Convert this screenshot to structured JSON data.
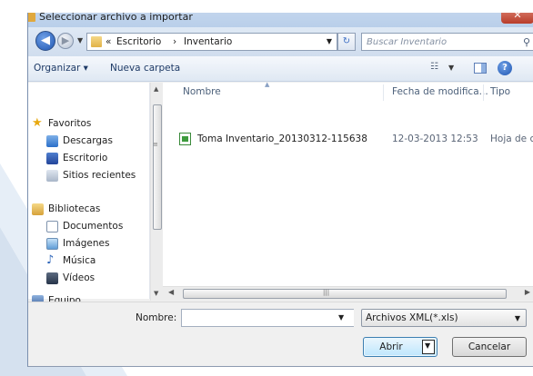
{
  "window": {
    "title": "Seleccionar archivo a importar",
    "close_glyph": "✕"
  },
  "address": {
    "overflow": "«",
    "crumbs": [
      "Escritorio",
      "Inventario"
    ],
    "separator": "›",
    "search_placeholder": "Buscar Inventario"
  },
  "toolbar": {
    "organize_label": "Organizar ▾",
    "new_folder_label": "Nueva carpeta"
  },
  "sidebar": {
    "favorites_header": "Favoritos",
    "favorites": [
      "Descargas",
      "Escritorio",
      "Sitios recientes"
    ],
    "libraries_header": "Bibliotecas",
    "libraries": [
      "Documentos",
      "Imágenes",
      "Música",
      "Vídeos"
    ],
    "computer_header": "Equipo"
  },
  "columns": {
    "name": "Nombre",
    "date": "Fecha de modifica...",
    "type": "Tipo"
  },
  "files": [
    {
      "name": "Toma Inventario_20130312-115638",
      "date": "12-03-2013 12:53",
      "type": "Hoja de c"
    }
  ],
  "bottom": {
    "name_label": "Nombre:",
    "name_value": "",
    "filetype_selected": "Archivos XML(*.xls)",
    "open_label": "Abrir",
    "cancel_label": "Cancelar"
  },
  "colors": {
    "accent": "#1f56b2",
    "titlebar": "#c7d8ee",
    "link_text": "#1e3a66"
  }
}
